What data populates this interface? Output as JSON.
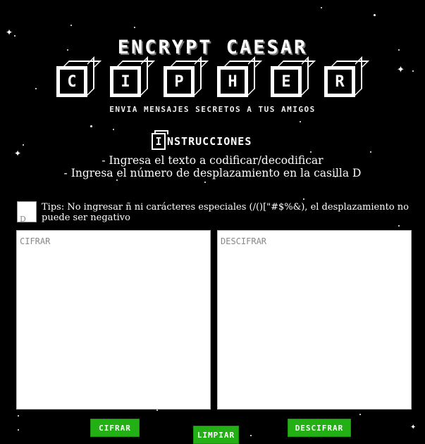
{
  "header": {
    "title_line": "ENCRYPT CAESAR",
    "cipher_letters": [
      "C",
      "I",
      "P",
      "H",
      "E",
      "R"
    ],
    "subtitle": "ENVIA MENSAJES SECRETOS A TUS AMIGOS"
  },
  "instructions": {
    "icon_letter": "I",
    "heading": "NSTRUCCIONES",
    "line1": "- Ingresa el texto a codificar/decodificar",
    "line2": "- Ingresa el número de desplazamiento en la casilla D"
  },
  "shift_input": {
    "placeholder": "D"
  },
  "tips": "Tips: No ingresar ñ ni carácteres especiales (/()[\"#$%&), el desplazamiento no puede ser negativo",
  "editors": {
    "cifrar_placeholder": "CIFRAR",
    "descifrar_placeholder": "DESCIFRAR"
  },
  "buttons": {
    "cifrar": "CIFRAR",
    "limpiar": "LIMPIAR",
    "descifrar": "DESCIFRAR"
  },
  "colors": {
    "background": "#000000",
    "button_green": "#22b014"
  }
}
